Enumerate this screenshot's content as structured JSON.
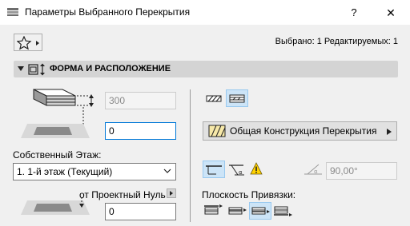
{
  "window": {
    "title": "Параметры Выбранного Перекрытия",
    "help_label": "?",
    "close_label": "✕"
  },
  "toolbar": {
    "favorites_icon": "star-icon",
    "selected_info": "Выбрано: 1 Редактируемых: 1"
  },
  "section": {
    "title": "ФОРМА И РАСПОЛОЖЕНИЕ",
    "expanded": true
  },
  "geometry": {
    "thickness_value": "300",
    "thickness_disabled": true,
    "offset_top_value": "0",
    "home_story_label": "Собственный Этаж:",
    "home_story_value": "1. 1-й этаж (Текущий)",
    "offset_to_label": "от Проектный Нуль",
    "offset_to_value": "0"
  },
  "structure": {
    "view_mode_1_icon": "cut-slab-icon",
    "view_mode_2_icon": "cut-slab-outline-icon",
    "composite_label": "Общая Конструкция Перекрытия",
    "slope_value": "90,00°",
    "slope_disabled": true,
    "warning_icon": "warning-icon",
    "reference_plane_label": "Плоскость Привязки:"
  },
  "colors": {
    "accent": "#0078d7",
    "active_button": "#cce4f7",
    "section_header": "#d4d4d4",
    "warning": "#ffd200"
  }
}
